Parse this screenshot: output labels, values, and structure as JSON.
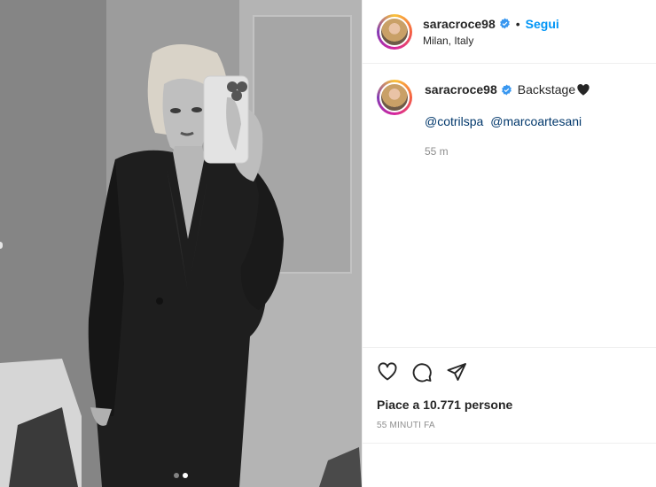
{
  "post": {
    "username": "saracroce98",
    "follow_label": "Segui",
    "separator": "•",
    "location": "Milan, Italy",
    "caption_text": "Backstage",
    "mentions": [
      "@cotrilspa",
      "@marcoartesani"
    ],
    "comment_time": "55 m",
    "likes_text": "Piace a 10.771 persone",
    "posted_ago": "55 MINUTI FA"
  },
  "carousel": {
    "total": 2,
    "active_index": 2
  },
  "icons": {
    "verified": "verified-badge-icon",
    "caption_heart": "black-heart-icon",
    "like": "heart-icon",
    "comment": "comment-icon",
    "share": "share-icon"
  },
  "colors": {
    "link_blue": "#0095f6",
    "mention_blue": "#00376b",
    "muted": "#8e8e8e",
    "verified_blue": "#3897f0"
  }
}
